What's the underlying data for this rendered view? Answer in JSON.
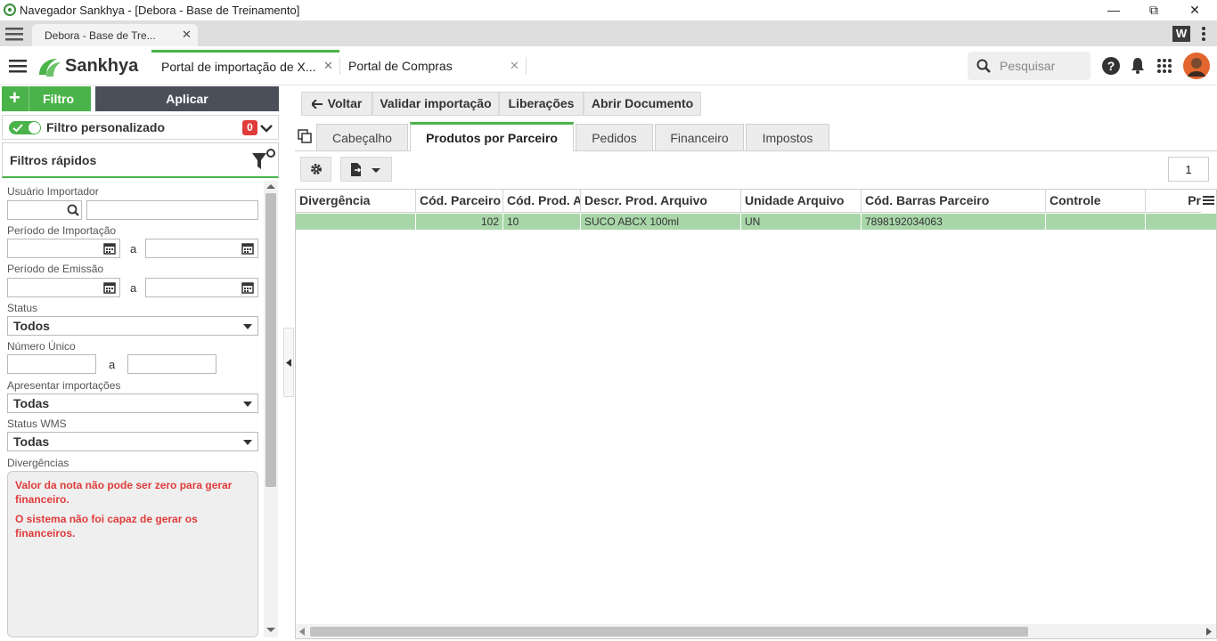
{
  "window": {
    "title": "Navegador Sankhya - [Debora - Base de Treinamento]",
    "min": "—",
    "restore": "⧉",
    "close": "✕"
  },
  "browser_tab": {
    "label": "Debora - Base de Tre...",
    "close": "✕"
  },
  "header": {
    "brand": "Sankhya",
    "tabs": [
      {
        "label": "Portal de importação de X...",
        "close": "✕"
      },
      {
        "label": "Portal de Compras",
        "close": "✕"
      }
    ],
    "search_placeholder": "Pesquisar"
  },
  "left": {
    "filtro_btn": "Filtro",
    "aplicar_btn": "Aplicar",
    "filtro_personalizado": "Filtro personalizado",
    "filtro_count": "0",
    "filtros_rapidos": "Filtros rápidos",
    "usuario_importador": "Usuário Importador",
    "periodo_importacao": "Período de Importação",
    "periodo_emissao": "Período de Emissão",
    "a": "a",
    "status_label": "Status",
    "status_value": "Todos",
    "numero_unico": "Número Único",
    "apresentar_label": "Apresentar importações",
    "apresentar_value": "Todas",
    "status_wms_label": "Status WMS",
    "status_wms_value": "Todas",
    "divergencias_label": "Divergências",
    "divergencias": [
      "Valor da nota não pode ser zero para gerar financeiro.",
      "O sistema não foi capaz de gerar os financeiros."
    ]
  },
  "toolbar": {
    "voltar": "Voltar",
    "validar": "Validar importação",
    "liberacoes": "Liberações",
    "abrir": "Abrir Documento"
  },
  "tabs": [
    "Cabeçalho",
    "Produtos por Parceiro",
    "Pedidos",
    "Financeiro",
    "Impostos"
  ],
  "active_tab": "Produtos por Parceiro",
  "page_number": "1",
  "grid": {
    "columns": [
      "Divergência",
      "Cód. Parceiro",
      "Cód. Prod. A",
      "Descr. Prod. Arquivo",
      "Unidade Arquivo",
      "Cód. Barras Parceiro",
      "Controle",
      "Pr"
    ],
    "rows": [
      [
        "",
        "102",
        "10",
        "SUCO ABCX 100ml",
        "UN",
        "7898192034063",
        "",
        ""
      ]
    ]
  },
  "colors": {
    "accent": "#4ab34a",
    "dark": "#4a4f59",
    "row": "#a9d6a9",
    "error": "#e03b3b"
  }
}
